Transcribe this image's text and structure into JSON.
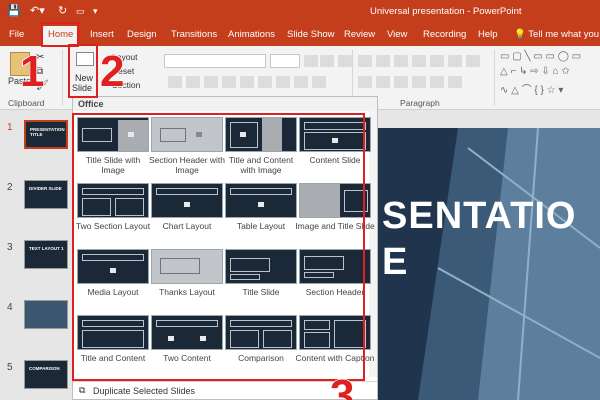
{
  "titlebar": {
    "title": "Universal presentation  -  PowerPoint",
    "icons": [
      "save-icon",
      "undo-icon",
      "redo-icon",
      "start-from-beginning-icon",
      "customize-icon"
    ]
  },
  "tabs": [
    "File",
    "Home",
    "Insert",
    "Design",
    "Transitions",
    "Animations",
    "Slide Show",
    "Review",
    "View",
    "Recording",
    "Help"
  ],
  "active_tab": "Home",
  "tell_me": "Tell me what you",
  "ribbon": {
    "paste": "Paste",
    "new_slide": "New",
    "new_slide_2": "Slide",
    "layout": "Layout",
    "reset": "Reset",
    "section": "Section",
    "clipboard_label": "Clipboard",
    "paragraph_label": "Paragraph"
  },
  "gallery": {
    "header": "Office",
    "layouts": [
      "Title Slide with Image",
      "Section Header with Image",
      "Title and Content with Image",
      "Content Slide",
      "Two Section Layout",
      "Chart Layout",
      "Table Layout",
      "Image and Title Slide",
      "Media Layout",
      "Thanks Layout",
      "Title Slide",
      "Section Header",
      "Title and Content",
      "Two Content",
      "Comparison",
      "Content with Caption"
    ],
    "duplicate": "Duplicate Selected Slides"
  },
  "thumbnails": {
    "numbers": [
      "1",
      "2",
      "3",
      "4",
      "5"
    ],
    "selected": "1",
    "labels": [
      "PRESENTATION TITLE",
      "DIVIDER SLIDE",
      "TEXT LAYOUT 1",
      "",
      "COMPARISON"
    ]
  },
  "slide": {
    "title": "SENTATIO\nE"
  },
  "annotations": [
    "1",
    "2",
    "3"
  ],
  "colors": {
    "accent": "#c43e1c",
    "annotation": "#e02020",
    "slide_bg": "#20354d"
  }
}
